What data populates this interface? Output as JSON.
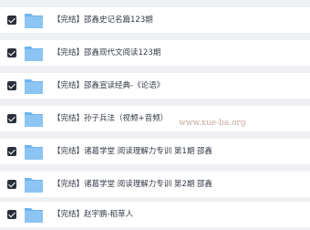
{
  "files": [
    {
      "label": "【完结】邵鑫史记名篇123期",
      "checked": true,
      "icon": "folder-icon"
    },
    {
      "label": "【完结】邵鑫现代文阅读123期",
      "checked": true,
      "icon": "folder-icon"
    },
    {
      "label": "【完结】邵鑫宣读经典-《论语》",
      "checked": true,
      "icon": "folder-icon"
    },
    {
      "label": "【完结】孙子兵法（视频+音频）",
      "checked": true,
      "icon": "folder-icon"
    },
    {
      "label": "【完结】诸葛学堂 阅读理解力专训 第1期 邵鑫",
      "checked": true,
      "icon": "folder-icon"
    },
    {
      "label": "【完结】诸葛学堂 阅读理解力专训 第2期 邵鑫",
      "checked": true,
      "icon": "folder-icon"
    },
    {
      "label": "【完结】赵宇鹏-稻草人",
      "checked": true,
      "icon": "folder-icon"
    }
  ],
  "watermark": "www.xue-ba.org",
  "colors": {
    "folder": "#6fb3ef",
    "checkbox": "#2b2f3a",
    "background": "#eef0f3"
  }
}
